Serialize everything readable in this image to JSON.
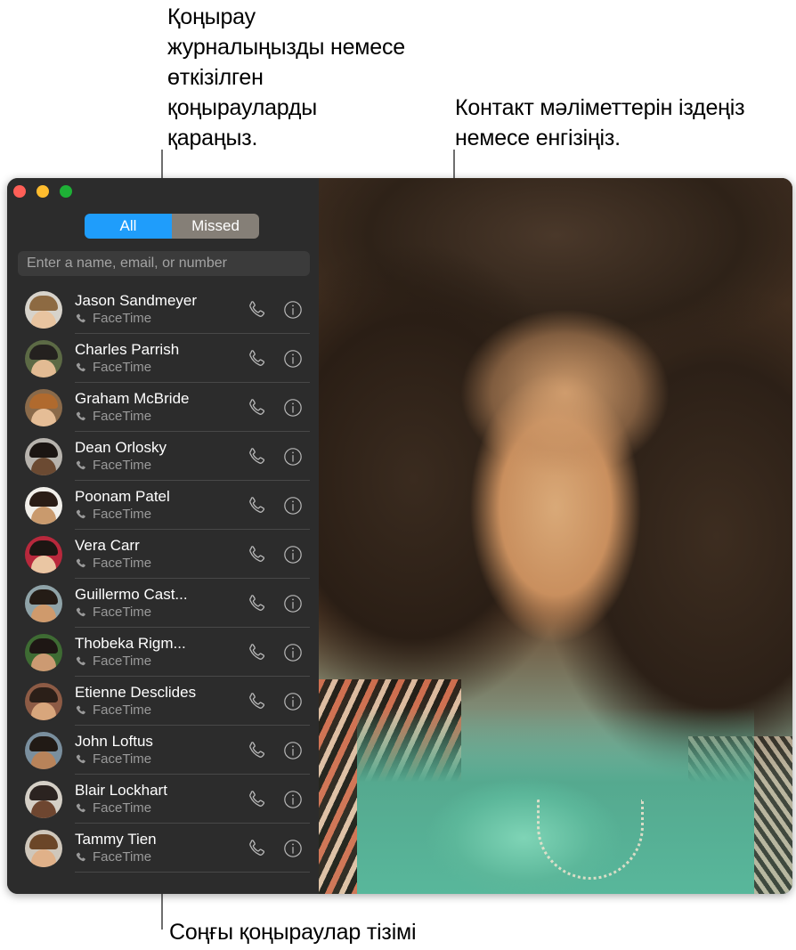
{
  "annotations": {
    "call_log_callout": "Қоңырау журналыңызды немесе өткізілген қоңырауларды қараңыз.",
    "contact_callout": "Контакт мәліметтерін іздеңіз немесе енгізіңіз.",
    "recents_caption": "Соңғы қоңыраулар тізімі"
  },
  "window": {
    "traffic_lights": {
      "close_label": "close-button",
      "minimize_label": "minimize-button",
      "zoom_label": "zoom-button",
      "close_color": "#ff5f57",
      "minimize_color": "#febc2e",
      "zoom_color": "#1eb036"
    }
  },
  "sidebar": {
    "segmented_control": {
      "options": [
        "All",
        "Missed"
      ],
      "selected": "All",
      "selected_color": "#1f9dfb",
      "unselected_color": "#857f77"
    },
    "search": {
      "placeholder": "Enter a name, email, or number",
      "value": ""
    },
    "calls": [
      {
        "name": "Jason Sandmeyer",
        "type": "FaceTime",
        "avatar_bg": "#d7d3cb",
        "skin": "#e8c4a0",
        "hair": "#8d6a42"
      },
      {
        "name": "Charles Parrish",
        "type": "FaceTime",
        "avatar_bg": "#5c6a45",
        "skin": "#e2bb93",
        "hair": "#24211f"
      },
      {
        "name": "Graham McBride",
        "type": "FaceTime",
        "avatar_bg": "#8a6a4a",
        "skin": "#e5bd96",
        "hair": "#b06a2e"
      },
      {
        "name": "Dean Orlosky",
        "type": "FaceTime",
        "avatar_bg": "#b7b3ad",
        "skin": "#6b4a32",
        "hair": "#1b1512"
      },
      {
        "name": "Poonam Patel",
        "type": "FaceTime",
        "avatar_bg": "#f1efea",
        "skin": "#c99a6d",
        "hair": "#2a1d16"
      },
      {
        "name": "Vera Carr",
        "type": "FaceTime",
        "avatar_bg": "#b8283c",
        "skin": "#eac6a3",
        "hair": "#1d1613"
      },
      {
        "name": "Guillermo Cast...",
        "type": "FaceTime",
        "avatar_bg": "#8fa3a8",
        "skin": "#cf9a6c",
        "hair": "#241c16"
      },
      {
        "name": "Thobeka Rigm...",
        "type": "FaceTime",
        "avatar_bg": "#3e6b33",
        "skin": "#cc9a72",
        "hair": "#1e1714"
      },
      {
        "name": "Etienne Desclides",
        "type": "FaceTime",
        "avatar_bg": "#8d5b45",
        "skin": "#d8a67c",
        "hair": "#2b1f18"
      },
      {
        "name": "John Loftus",
        "type": "FaceTime",
        "avatar_bg": "#7a8f9e",
        "skin": "#b8835a",
        "hair": "#211a15"
      },
      {
        "name": "Blair Lockhart",
        "type": "FaceTime",
        "avatar_bg": "#d4cfc6",
        "skin": "#6e4630",
        "hair": "#2b2320"
      },
      {
        "name": "Tammy Tien",
        "type": "FaceTime",
        "avatar_bg": "#cfc7bb",
        "skin": "#e0b189",
        "hair": "#6b4628"
      }
    ],
    "icons": {
      "call_action": "phone-icon",
      "info_action": "info-icon",
      "subtitle_glyph": "phone-handset-icon"
    }
  }
}
